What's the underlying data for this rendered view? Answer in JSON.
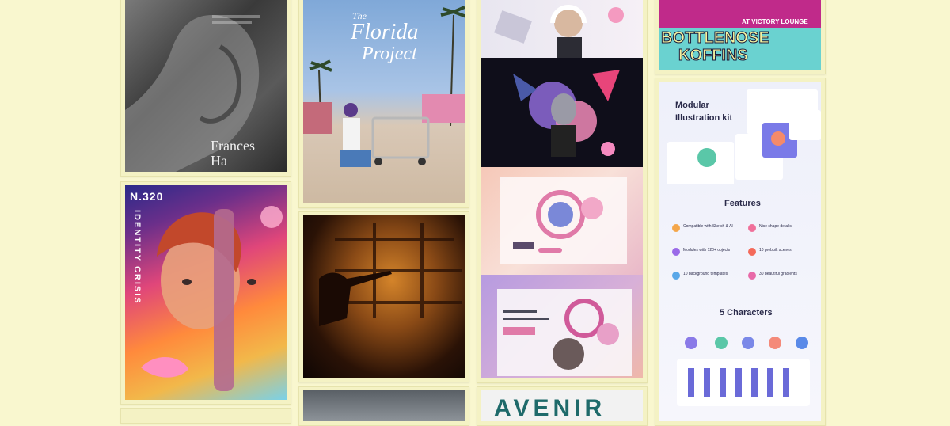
{
  "colors": {
    "page_bg": "#f9f7cf",
    "card_bg": "#f4f2c4"
  },
  "pins": {
    "frances_ha": {
      "title_line1": "Frances",
      "title_line2": "Ha"
    },
    "identity_crisis": {
      "number": "N.320",
      "vertical_title": "IDENTITY CRISIS"
    },
    "florida_project": {
      "title_line1": "The",
      "title_line2": "Florida",
      "title_line3": "Project"
    },
    "bottlenose": {
      "lounge": "AT VICTORY LOUNGE",
      "line1": "BOTTLENOSE",
      "line2": "KOFFINS"
    },
    "illustration_kit": {
      "title": "Modular Illustration kit",
      "features_heading": "Features",
      "features": [
        "Compatible with Sketch & AI",
        "Nice shape details",
        "Modules with 120+ objects",
        "10 prebuilt scenes",
        "10 background templates",
        "30 beautiful gradients"
      ],
      "characters_heading": "5 Characters"
    },
    "avenir": {
      "wordmark": "AVENIR"
    }
  }
}
